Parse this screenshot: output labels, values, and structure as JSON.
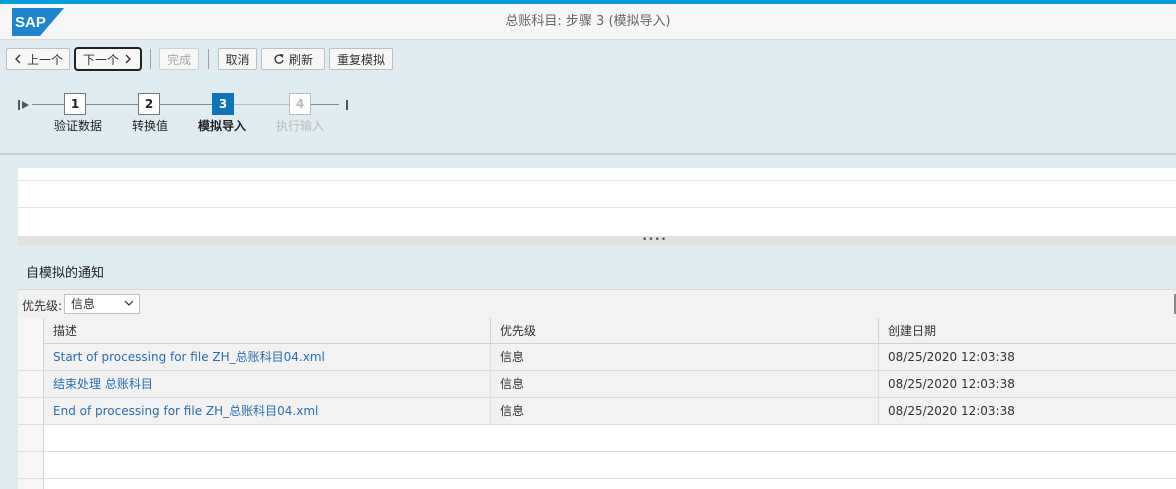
{
  "header": {
    "logo_text": "SAP",
    "title": "总账科目: 步骤 3  (模拟导入)"
  },
  "toolbar": {
    "prev_label": "上一个",
    "next_label": "下一个",
    "finish_label": "完成",
    "cancel_label": "取消",
    "refresh_label": "刷新",
    "resimulate_label": "重复模拟"
  },
  "wizard": {
    "steps": [
      {
        "number": "1",
        "label": "验证数据",
        "state": "done"
      },
      {
        "number": "2",
        "label": "转换值",
        "state": "done"
      },
      {
        "number": "3",
        "label": "模拟导入",
        "state": "active"
      },
      {
        "number": "4",
        "label": "执行输入",
        "state": "inactive"
      }
    ]
  },
  "splitter": {
    "grip": "••••"
  },
  "messages": {
    "title": "自模拟的通知",
    "filter_label": "优先级:",
    "filter_value": "信息",
    "columns": [
      "描述",
      "优先级",
      "创建日期"
    ],
    "rows": [
      {
        "description": "Start of processing for file ZH_总账科目04.xml",
        "priority": "信息",
        "created": "08/25/2020 12:03:38"
      },
      {
        "description": "结束处理 总账科目",
        "priority": "信息",
        "created": "08/25/2020 12:03:38"
      },
      {
        "description": "End of processing for file ZH_总账科目04.xml",
        "priority": "信息",
        "created": "08/25/2020 12:03:38"
      }
    ]
  },
  "colors": {
    "accent": "#009de0",
    "active_step": "#0e74b7",
    "link": "#2a6fab",
    "background": "#dfecf1"
  }
}
